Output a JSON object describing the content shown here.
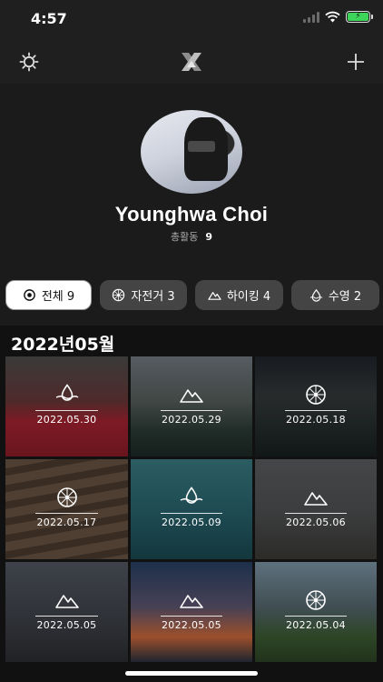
{
  "status_bar": {
    "time": "4:57"
  },
  "profile": {
    "name": "Younghwa Choi",
    "stats_label": "총활동",
    "stats_value": "9"
  },
  "filters": [
    {
      "label": "전체 9",
      "icon": "eye-icon",
      "active": true
    },
    {
      "label": "자전거 3",
      "icon": "bike-wheel-icon",
      "active": false
    },
    {
      "label": "하이킹 4",
      "icon": "mountain-icon",
      "active": false
    },
    {
      "label": "수영 2",
      "icon": "water-drop-icon",
      "active": false
    }
  ],
  "month_title": "2022년05월",
  "activities": [
    {
      "date": "2022.05.30",
      "icon": "water-drop-icon"
    },
    {
      "date": "2022.05.29",
      "icon": "mountain-icon"
    },
    {
      "date": "2022.05.18",
      "icon": "bike-wheel-icon"
    },
    {
      "date": "2022.05.17",
      "icon": "bike-wheel-icon"
    },
    {
      "date": "2022.05.09",
      "icon": "water-drop-icon"
    },
    {
      "date": "2022.05.06",
      "icon": "mountain-icon"
    },
    {
      "date": "2022.05.05",
      "icon": "mountain-icon"
    },
    {
      "date": "2022.05.05",
      "icon": "mountain-icon"
    },
    {
      "date": "2022.05.04",
      "icon": "bike-wheel-icon"
    }
  ],
  "colors": {
    "background": "#111111",
    "header": "#1f1f1f",
    "chip": "#444444",
    "chip_active": "#ffffff",
    "battery": "#3ed35a"
  }
}
